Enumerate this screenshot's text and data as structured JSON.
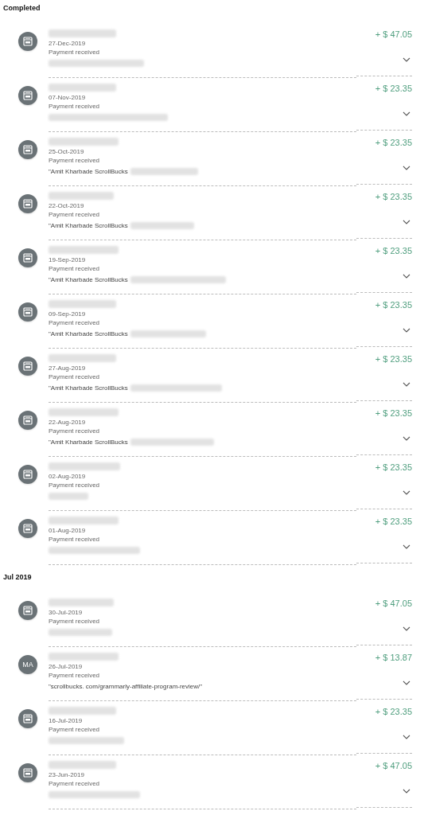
{
  "sections": [
    {
      "heading": "Completed",
      "transactions": [
        {
          "avatar": {
            "kind": "icon"
          },
          "date": "27-Dec-2019",
          "status": "Payment received",
          "amount": "+ $ 47.05"
        },
        {
          "avatar": {
            "kind": "icon"
          },
          "date": "07-Nov-2019",
          "status": "Payment received",
          "amount": "+ $ 23.35"
        },
        {
          "avatar": {
            "kind": "icon"
          },
          "date": "25-Oct-2019",
          "status": "Payment received",
          "amount": "+ $ 23.35",
          "memo": "\"Amit Kharbade ScrollBucks"
        },
        {
          "avatar": {
            "kind": "icon"
          },
          "date": "22-Oct-2019",
          "status": "Payment received",
          "amount": "+ $ 23.35",
          "memo": "\"Amit Kharbade ScrollBucks"
        },
        {
          "avatar": {
            "kind": "icon"
          },
          "date": "19-Sep-2019",
          "status": "Payment received",
          "amount": "+ $ 23.35",
          "memo": "\"Amit Kharbade ScrollBucks"
        },
        {
          "avatar": {
            "kind": "icon"
          },
          "date": "09-Sep-2019",
          "status": "Payment received",
          "amount": "+ $ 23.35",
          "memo": "\"Amit Kharbade ScrollBucks"
        },
        {
          "avatar": {
            "kind": "icon"
          },
          "date": "27-Aug-2019",
          "status": "Payment received",
          "amount": "+ $ 23.35",
          "memo": "\"Amit Kharbade ScrollBucks"
        },
        {
          "avatar": {
            "kind": "icon"
          },
          "date": "22-Aug-2019",
          "status": "Payment received",
          "amount": "+ $ 23.35",
          "memo": "\"Amit Kharbade ScrollBucks"
        },
        {
          "avatar": {
            "kind": "icon"
          },
          "date": "02-Aug-2019",
          "status": "Payment received",
          "amount": "+ $ 23.35"
        },
        {
          "avatar": {
            "kind": "icon"
          },
          "date": "01-Aug-2019",
          "status": "Payment received",
          "amount": "+ $ 23.35"
        }
      ]
    },
    {
      "heading": "Jul 2019",
      "transactions": [
        {
          "avatar": {
            "kind": "icon"
          },
          "date": "30-Jul-2019",
          "status": "Payment received",
          "amount": "+ $ 47.05"
        },
        {
          "avatar": {
            "kind": "initials",
            "text": "MA"
          },
          "date": "26-Jul-2019",
          "status": "Payment received",
          "amount": "+ $ 13.87",
          "memo": "\"scrollbucks. com/grammarly-affiliate-program-review/\""
        },
        {
          "avatar": {
            "kind": "icon"
          },
          "date": "16-Jul-2019",
          "status": "Payment received",
          "amount": "+ $ 23.35"
        },
        {
          "avatar": {
            "kind": "icon"
          },
          "date": "23-Jun-2019",
          "status": "Payment received",
          "amount": "+ $ 47.05"
        }
      ]
    }
  ]
}
